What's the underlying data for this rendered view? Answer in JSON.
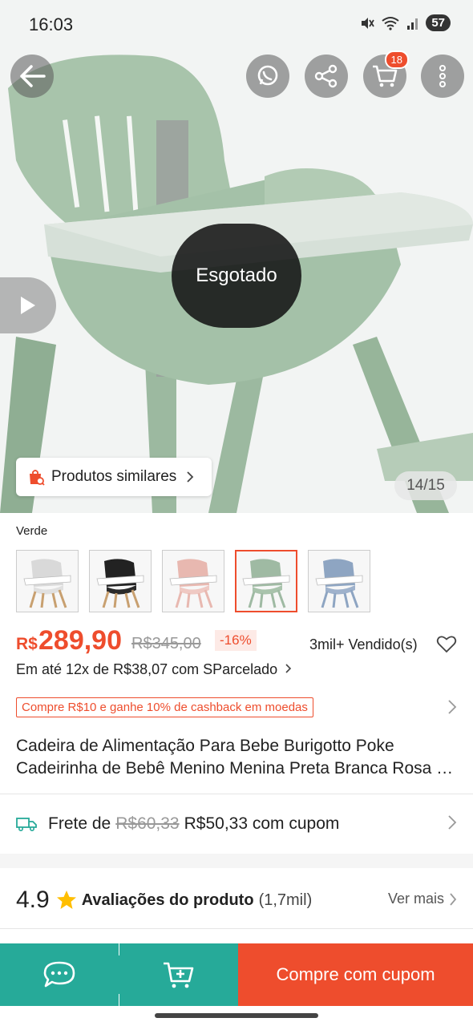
{
  "status_bar": {
    "time": "16:03",
    "battery": "57"
  },
  "header": {
    "cart_count": "18"
  },
  "hero": {
    "sold_out_label": "Esgotado",
    "similar_products_label": "Produtos similares",
    "image_counter": "14/15"
  },
  "variation": {
    "selected_label": "Verde",
    "options": [
      {
        "color": "#e0e0e0",
        "seat": "#d9d9d9",
        "legs": "#c8a070"
      },
      {
        "color": "#2a2a2a",
        "seat": "#222222",
        "legs": "#c8a070"
      },
      {
        "color": "#efc9c3",
        "seat": "#e8b8b0",
        "legs": "#e8b8b0"
      },
      {
        "color": "#a9c3ac",
        "seat": "#9fbaa3",
        "legs": "#9fbaa3"
      },
      {
        "color": "#9fb2cc",
        "seat": "#8ea5c2",
        "legs": "#8ea5c2"
      }
    ],
    "selected_index": 3
  },
  "price": {
    "currency": "R$",
    "current": "289,90",
    "original": "R$345,00",
    "discount": "-16%",
    "sold": "3mil+ Vendido(s)",
    "installments": "Em até 12x de R$38,07 com SParcelado"
  },
  "cashback": "Compre R$10 e ganhe 10% de cashback em moedas",
  "product": {
    "title_line1": "Cadeira de Alimentação Para Bebe Burigotto Poke",
    "title_line2": "Cadeirinha de Bebê Menino Menina Preta Branca Rosa Verde"
  },
  "shipping": {
    "label": "Frete de",
    "original": "R$60,33",
    "discounted": "R$50,33 com cupom"
  },
  "rating": {
    "score": "4.9",
    "label": "Avaliações do produto",
    "count": "(1,7mil)",
    "see_more": "Ver mais"
  },
  "bottom_bar": {
    "buy_label": "Compre com cupom"
  },
  "colors": {
    "accent": "#ee4d2d",
    "chat_green": "#26aa99",
    "chair_green": "#a9c3ac"
  }
}
